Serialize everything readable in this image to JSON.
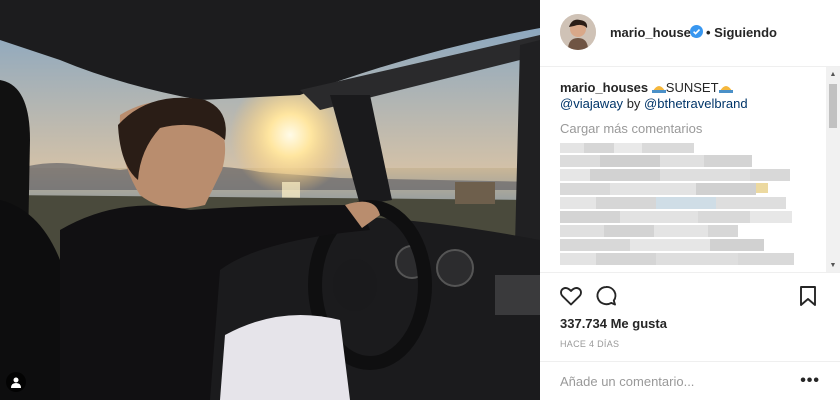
{
  "post": {
    "username": "mario_houses",
    "follow_status": "• Siguiendo",
    "caption": {
      "username": "mario_houses",
      "text": "SUNSET",
      "mention1": "@viajaway",
      "by": "by",
      "mention2": "@bthetravelbrand"
    },
    "load_more": "Cargar más comentarios",
    "likes": "337.734 Me gusta",
    "time_ago": "HACE 4 DÍAS",
    "comment_placeholder": "Añade un comentario...",
    "more_options": "•••"
  },
  "icons": {
    "verified": "verified-badge-icon",
    "sunset_emoji": "sunset-emoji-icon",
    "like": "heart-icon",
    "comment": "speech-bubble-icon",
    "save": "bookmark-icon",
    "tag": "user-tag-icon"
  },
  "colors": {
    "verified": "#3897f0",
    "link": "#003569",
    "muted": "#999999",
    "text": "#262626"
  }
}
